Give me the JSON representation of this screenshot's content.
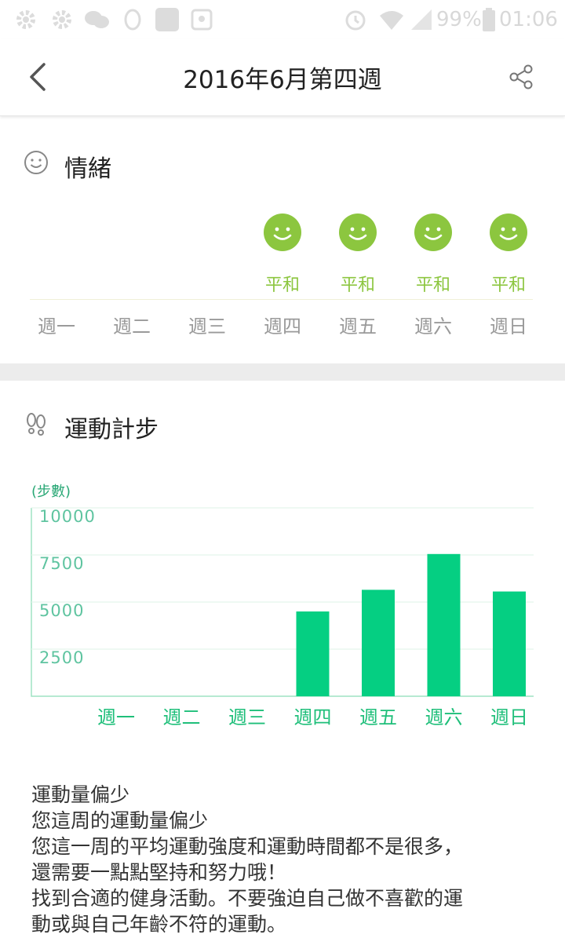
{
  "status_bar": {
    "battery": "99%",
    "time": "01:06"
  },
  "header": {
    "title": "2016年6月第四週",
    "back_icon": "chevron-left-icon",
    "share_icon": "share-icon"
  },
  "mood": {
    "title": "情緒",
    "icon": "smiley-outline-icon",
    "days": [
      {
        "day": "週一",
        "mood": ""
      },
      {
        "day": "週二",
        "mood": ""
      },
      {
        "day": "週三",
        "mood": ""
      },
      {
        "day": "週四",
        "mood": "平和"
      },
      {
        "day": "週五",
        "mood": "平和"
      },
      {
        "day": "週六",
        "mood": "平和"
      },
      {
        "day": "週日",
        "mood": "平和"
      }
    ],
    "mood_color": "#8cc63f"
  },
  "steps": {
    "title": "運動計步",
    "icon": "footprints-icon"
  },
  "chart_data": {
    "type": "bar",
    "ylabel": "(步數)",
    "categories": [
      "週一",
      "週二",
      "週三",
      "週四",
      "週五",
      "週六",
      "週日"
    ],
    "values": [
      0,
      0,
      0,
      4500,
      5650,
      7550,
      5560
    ],
    "ylim": [
      0,
      10000
    ],
    "yticks": [
      "10000",
      "7500",
      "5000",
      "2500"
    ],
    "grid": true,
    "bar_color": "#05cf82"
  },
  "summary": {
    "lines": [
      "運動量偏少",
      "您這周的運動量偏少",
      "您這一周的平均運動強度和運動時間都不是很多，",
      "還需要一點點堅持和努力哦！",
      "找到合適的健身活動。不要強迫自己做不喜歡的運",
      "動或與自己年齡不符的運動。"
    ]
  }
}
